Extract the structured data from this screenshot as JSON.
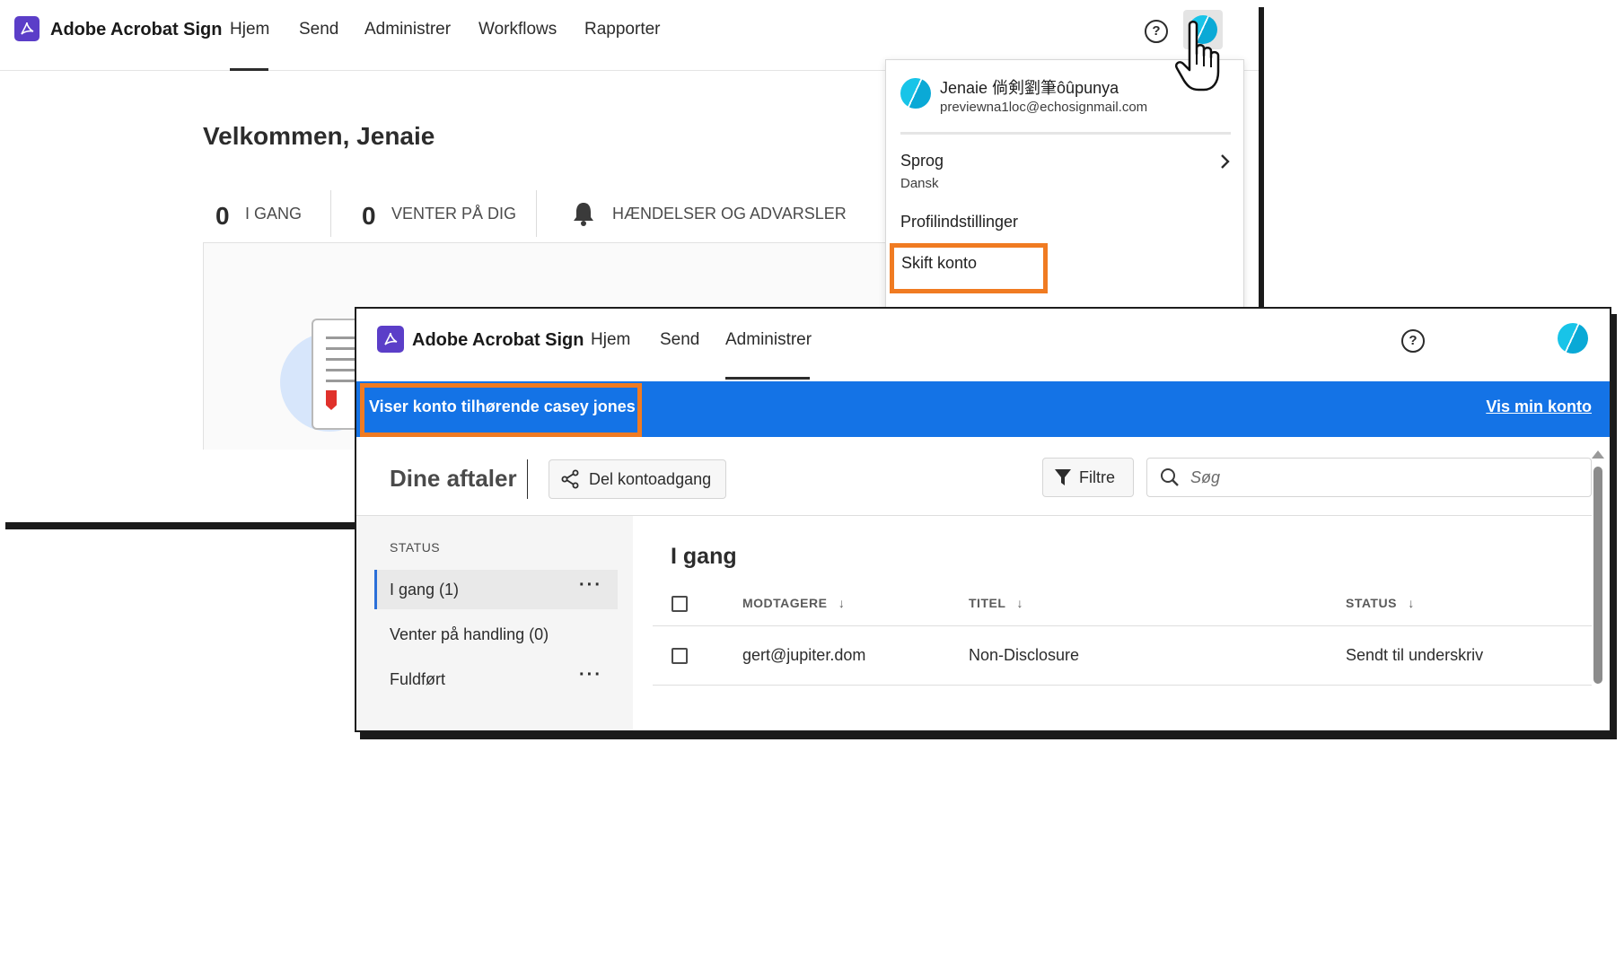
{
  "back": {
    "brand": "Adobe Acrobat Sign",
    "nav": [
      "Hjem",
      "Send",
      "Administrer",
      "Workflows",
      "Rapporter"
    ],
    "welcome": "Velkommen, Jenaie",
    "stats": [
      {
        "num": "0",
        "label": "I GANG"
      },
      {
        "num": "0",
        "label": "VENTER PÅ DIG"
      }
    ],
    "events_label": "HÆNDELSER OG ADVARSLER",
    "help_glyph": "?",
    "menu": {
      "name": "Jenaie 倘剣劉筆ôûpunya",
      "email": "previewna1loc@echosignmail.com",
      "language_label": "Sprog",
      "language_value": "Dansk",
      "profile_settings": "Profilindstillinger",
      "switch_account": "Skift konto"
    }
  },
  "front": {
    "brand": "Adobe Acrobat Sign",
    "nav": [
      "Hjem",
      "Send",
      "Administrer"
    ],
    "help_glyph": "?",
    "banner_text": "Viser konto tilhørende casey jones",
    "banner_link": "Vis min konto",
    "page_title": "Dine aftaler",
    "share_button": "Del kontoadgang",
    "filter_button": "Filtre",
    "search_placeholder": "Søg",
    "sidebar": {
      "heading": "STATUS",
      "items": [
        "I gang (1)",
        "Venter på handling (0)",
        "Fuldført"
      ]
    },
    "section_title": "I gang",
    "columns": [
      "MODTAGERE",
      "TITEL",
      "STATUS"
    ],
    "rows": [
      {
        "recipient": "gert@jupiter.dom",
        "title": "Non-Disclosure",
        "status": "Sendt til underskriv"
      }
    ]
  },
  "colors": {
    "accent_blue": "#1473e6",
    "highlight_orange": "#f07b22",
    "brand_purple": "#5b3ec8",
    "avatar_cyan": "#18c4e8"
  },
  "icons": [
    "acrobat-logo-icon",
    "help-icon",
    "avatar-icon",
    "hand-cursor-icon",
    "bell-icon",
    "chevron-right-icon",
    "share-icon",
    "filter-icon",
    "search-icon",
    "sort-down-icon",
    "more-icon",
    "checkbox-icon"
  ]
}
